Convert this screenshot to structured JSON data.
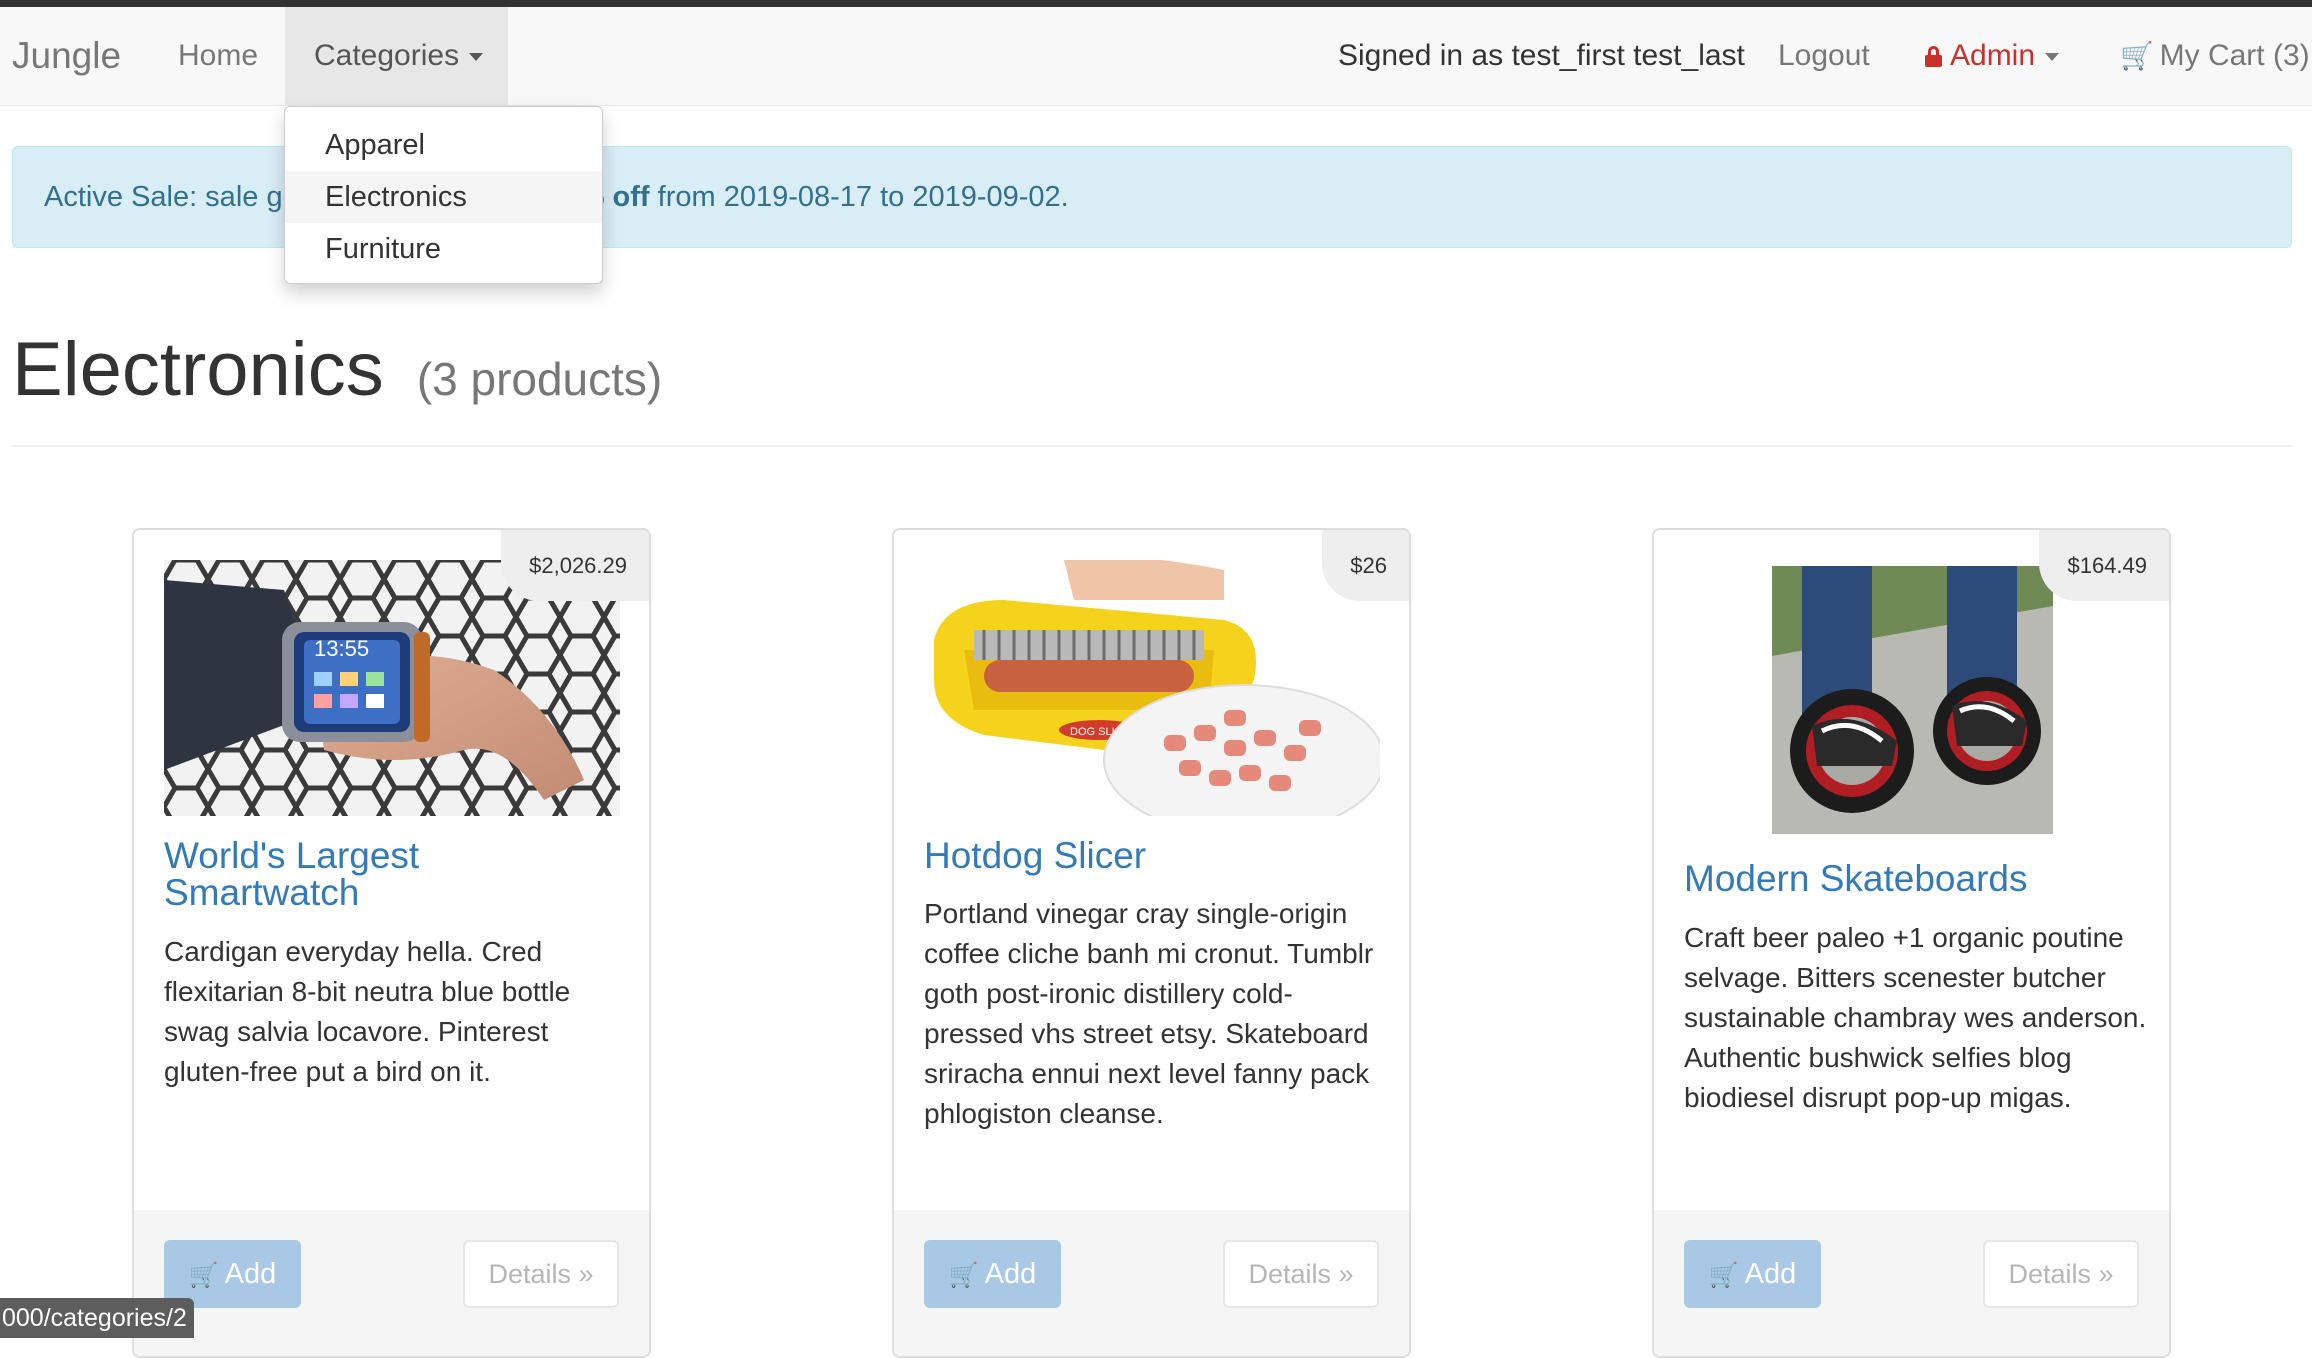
{
  "navbar": {
    "brand": "Jungle",
    "home": "Home",
    "categories": "Categories",
    "signed_in": "Signed in as test_first test_last",
    "logout": "Logout",
    "admin": "Admin",
    "cart": "My Cart (3)"
  },
  "dropdown": {
    "items": [
      {
        "label": "Apparel"
      },
      {
        "label": "Electronics",
        "active": true
      },
      {
        "label": "Furniture"
      }
    ]
  },
  "alert": {
    "prefix": "Active Sale: sale go",
    "bold": "% off",
    "suffix": " from 2019-08-17 to 2019-09-02."
  },
  "page": {
    "title": "Electronics",
    "count": "(3 products)"
  },
  "products": [
    {
      "price": "$2,026.29",
      "name": "World's Largest Smartwatch",
      "description": "Cardigan everyday hella. Cred flexitarian 8-bit neutra blue bottle swag salvia locavore. Pinterest gluten-free put a bird on it.",
      "image_text": "13:55",
      "add_label": "Add",
      "details_label": "Details »"
    },
    {
      "price": "$26",
      "name": "Hotdog Slicer",
      "description": "Portland vinegar cray single-origin coffee cliche banh mi cronut. Tumblr goth post-ironic distillery cold-pressed vhs street etsy. Skateboard sriracha ennui next level fanny pack phlogiston cleanse.",
      "image_text": "DOG SLICE",
      "add_label": "Add",
      "details_label": "Details »"
    },
    {
      "price": "$164.49",
      "name": "Modern Skateboards",
      "description": "Craft beer paleo +1 organic poutine selvage. Bitters scenester butcher sustainable chambray wes anderson. Authentic bushwick selfies blog biodiesel disrupt pop-up migas.",
      "add_label": "Add",
      "details_label": "Details »"
    }
  ],
  "status_bar": {
    "url": "000/categories/2"
  },
  "icons": {
    "cart": "shopping-cart-icon",
    "lock": "lock-icon",
    "caret": "caret-down-icon"
  },
  "colors": {
    "link": "#337ab7",
    "admin": "#c9302c",
    "alert_bg": "#d9edf7",
    "alert_text": "#31708f",
    "add_button": "#a9c8e6"
  }
}
